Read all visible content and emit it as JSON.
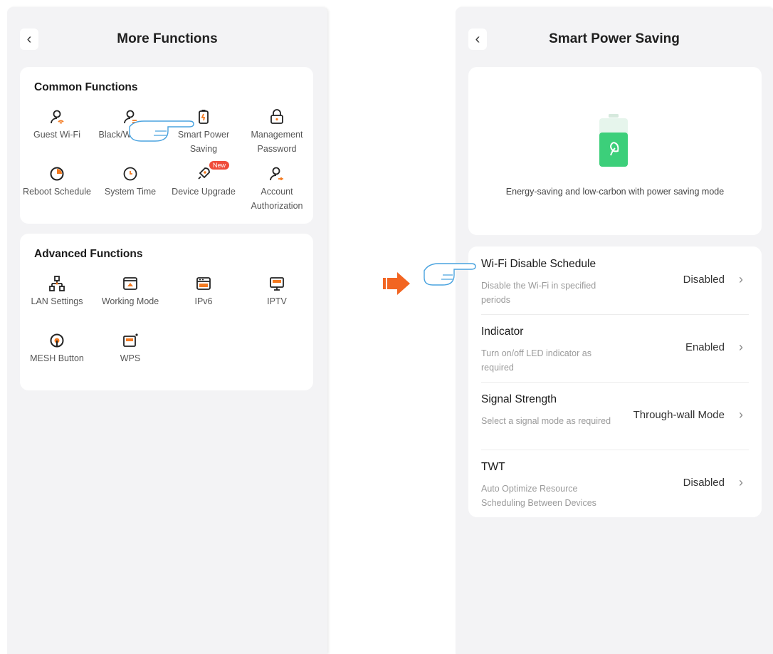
{
  "left": {
    "title": "More Functions",
    "common": {
      "heading": "Common Functions",
      "items": [
        {
          "label": "Guest Wi-Fi",
          "icon": "guest-wifi-icon"
        },
        {
          "label": "Black/White List",
          "icon": "person-list-icon"
        },
        {
          "label": "Smart Power Saving",
          "icon": "battery-saving-icon"
        },
        {
          "label": "Management Password",
          "icon": "lock-icon"
        },
        {
          "label": "Reboot Schedule",
          "icon": "reboot-icon"
        },
        {
          "label": "System Time",
          "icon": "clock-icon"
        },
        {
          "label": "Device Upgrade",
          "icon": "rocket-icon",
          "badge": "New"
        },
        {
          "label": "Account Authorization",
          "icon": "account-key-icon"
        }
      ]
    },
    "advanced": {
      "heading": "Advanced Functions",
      "items": [
        {
          "label": "LAN Settings",
          "icon": "network-icon"
        },
        {
          "label": "Working Mode",
          "icon": "working-mode-icon"
        },
        {
          "label": "IPv6",
          "icon": "ipv6-icon"
        },
        {
          "label": "IPTV",
          "icon": "iptv-icon"
        },
        {
          "label": "MESH Button",
          "icon": "mesh-button-icon"
        },
        {
          "label": "WPS",
          "icon": "wps-icon"
        }
      ]
    }
  },
  "right": {
    "title": "Smart Power Saving",
    "hero_text": "Energy-saving and low-carbon with power saving mode",
    "settings": [
      {
        "title": "Wi-Fi Disable Schedule",
        "desc": "Disable the Wi-Fi in specified periods",
        "value": "Disabled"
      },
      {
        "title": "Indicator",
        "desc": "Turn on/off LED indicator as required",
        "value": "Enabled"
      },
      {
        "title": "Signal Strength",
        "desc": "Select a signal mode as required",
        "value": "Through-wall Mode"
      },
      {
        "title": "TWT",
        "desc": "Auto Optimize Resource Scheduling Between Devices",
        "value": "Disabled"
      }
    ]
  },
  "colors": {
    "accent": "#f47a20",
    "battery": "#3ccf7a",
    "hand": "#4aa3df",
    "arrow": "#f26522"
  }
}
